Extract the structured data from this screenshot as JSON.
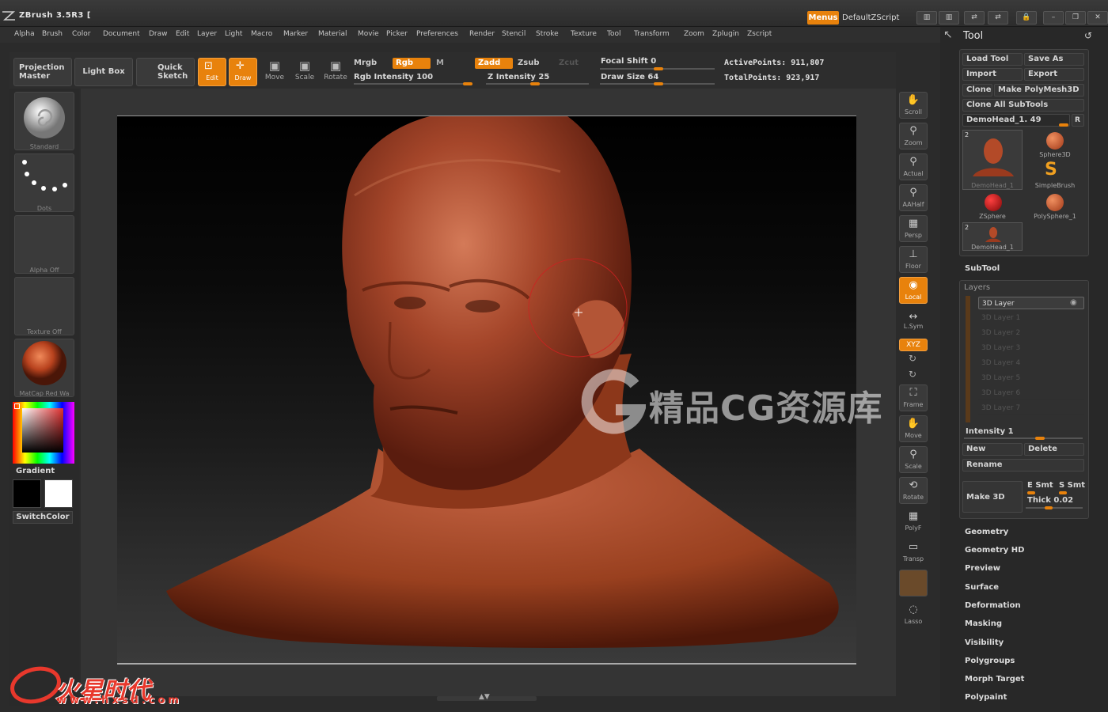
{
  "app": {
    "title": "ZBrush 3.5R3 ["
  },
  "titlebar": {
    "menus_label": "Menus",
    "zscript_label": "DefaultZScript"
  },
  "menu": [
    "Alpha",
    "Brush",
    "Color",
    "Document",
    "Draw",
    "Edit",
    "Layer",
    "Light",
    "Macro",
    "Marker",
    "Material",
    "Movie",
    "Picker",
    "Preferences",
    "Render",
    "Stencil",
    "Stroke",
    "Texture",
    "Tool",
    "Transform",
    "Zoom",
    "Zplugin",
    "Zscript"
  ],
  "shelf": {
    "projection_master": "Projection Master",
    "light_box": "Light Box",
    "quick_sketch": "Quick Sketch",
    "edit": "Edit",
    "draw": "Draw",
    "move": "Move",
    "scale": "Scale",
    "rotate": "Rotate",
    "mrgb": "Mrgb",
    "rgb": "Rgb",
    "m": "M",
    "zadd": "Zadd",
    "zsub": "Zsub",
    "zcut": "Zcut",
    "rgb_intensity": "Rgb Intensity 100",
    "z_intensity": "Z Intensity 25",
    "focal_shift": "Focal Shift 0",
    "draw_size": "Draw Size 64",
    "active_points": "ActivePoints: 911,807",
    "total_points": "TotalPoints: 923,917"
  },
  "left": {
    "brush": "Standard",
    "stroke": "Dots",
    "alpha": "Alpha Off",
    "texture": "Texture Off",
    "material": "MatCap Red Wa",
    "gradient": "Gradient",
    "switch_color": "SwitchColor",
    "colors": {
      "main": "#000000",
      "secondary": "#ffffff"
    }
  },
  "right_strip": [
    "Scroll",
    "Zoom",
    "Actual",
    "AAHalf",
    "Persp",
    "Floor",
    "Local",
    "L.Sym",
    "XYZ",
    "Frame",
    "Move",
    "Scale",
    "Rotate",
    "PolyF",
    "Transp",
    "Lasso"
  ],
  "tool_panel": {
    "title": "Tool",
    "load_tool": "Load Tool",
    "save_as": "Save As",
    "import": "Import",
    "export": "Export",
    "clone": "Clone",
    "make_polymesh": "Make PolyMesh3D",
    "clone_all": "Clone All SubTools",
    "slider": "DemoHead_1. 49",
    "slider_r": "R",
    "tools": [
      {
        "name": "DemoHead_1",
        "count": "2"
      },
      {
        "name": "Sphere3D",
        "count": ""
      },
      {
        "name": "SimpleBrush",
        "count": ""
      },
      {
        "name": "ZSphere",
        "count": ""
      },
      {
        "name": "PolySphere_1",
        "count": ""
      },
      {
        "name": "DemoHead_1",
        "count": "2"
      }
    ],
    "subtool": "SubTool",
    "layers_title": "Layers",
    "layers": [
      "3D Layer",
      "3D Layer 1",
      "3D Layer 2",
      "3D Layer 3",
      "3D Layer 4",
      "3D Layer 5",
      "3D Layer 6",
      "3D Layer 7"
    ],
    "intensity": "Intensity 1",
    "new": "New",
    "delete": "Delete",
    "rename": "Rename",
    "make_3d": "Make 3D",
    "e_smt": "E Smt",
    "s_smt": "S Smt",
    "thick": "Thick 0.02",
    "sections": [
      "Geometry",
      "Geometry HD",
      "Preview",
      "Surface",
      "Deformation",
      "Masking",
      "Visibility",
      "Polygroups",
      "Morph Target",
      "Polypaint"
    ]
  },
  "watermark": {
    "text": "精品CG资源库",
    "brand": "火星时代",
    "url": "www.hxsd.com"
  },
  "accent": "#e8820c"
}
